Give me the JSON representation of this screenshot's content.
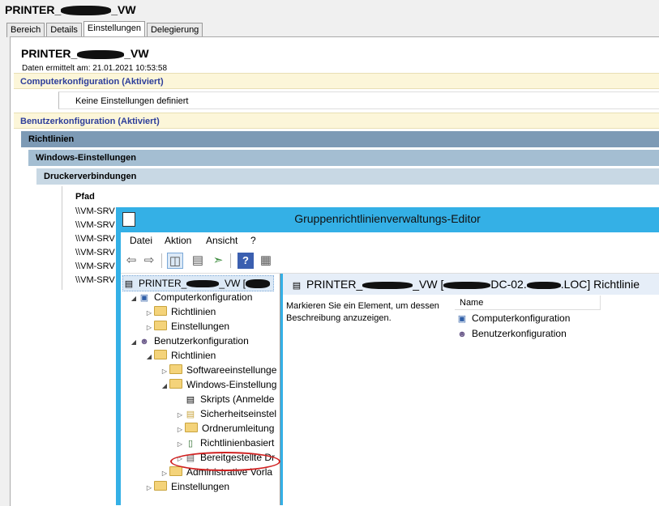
{
  "report": {
    "title_prefix": "PRINTER_",
    "title_suffix": "_VW",
    "tabs": [
      "Bereich",
      "Details",
      "Einstellungen",
      "Delegierung"
    ],
    "active_tab": "Einstellungen",
    "gpo_prefix": "PRINTER_",
    "gpo_suffix": "_VW",
    "date": "Daten ermittelt am: 21.01.2021 10:53:58",
    "computer_section": "Computerkonfiguration (Aktiviert)",
    "no_settings": "Keine Einstellungen definiert",
    "user_section": "Benutzerkonfiguration (Aktiviert)",
    "richtlinien": "Richtlinien",
    "windows_settings": "Windows-Einstellungen",
    "printer_connections": "Druckerverbindungen",
    "path_header": "Pfad",
    "paths": [
      "\\\\VM-SRV",
      "\\\\VM-SRV",
      "\\\\VM-SRV",
      "\\\\VM-SRV",
      "\\\\VM-SRV",
      "\\\\VM-SRV"
    ]
  },
  "editor": {
    "title": "Gruppenrichtlinienverwaltungs-Editor",
    "menu": [
      "Datei",
      "Aktion",
      "Ansicht",
      "?"
    ],
    "toolbar": [
      "back-icon",
      "forward-icon",
      "show-tree-icon",
      "properties-icon",
      "export-icon",
      "help-icon",
      "view-icon"
    ],
    "tree": {
      "root_prefix": "PRINTER_",
      "root_suffix": "_VW [",
      "computer": "Computerkonfiguration",
      "c_policies": "Richtlinien",
      "c_settings": "Einstellungen",
      "user": "Benutzerkonfiguration",
      "u_policies": "Richtlinien",
      "software": "Softwareeinstellunge",
      "windows": "Windows-Einstellung",
      "scripts": "Skripts (Anmelde",
      "security": "Sicherheitseinstel",
      "folder_redirect": "Ordnerumleitung",
      "policy_based": "Richtlinienbasiert",
      "deployed_printers": "Bereitgestellte Dr",
      "admin_templates": "Administrative Vorla",
      "u_settings": "Einstellungen"
    },
    "right": {
      "header_prefix": "PRINTER_",
      "header_mid": "_VW [",
      "header_mid2": "DC-02.",
      "header_suffix": ".LOC] Richtlinie",
      "description": "Markieren Sie ein Element, um dessen Beschreibung anzuzeigen.",
      "column_name": "Name",
      "items": [
        "Computerkonfiguration",
        "Benutzerkonfiguration"
      ]
    }
  },
  "colors": {
    "highlight_oval": "#d02020",
    "titlebar": "#34b0e6",
    "section_text": "#2c3d9a"
  }
}
